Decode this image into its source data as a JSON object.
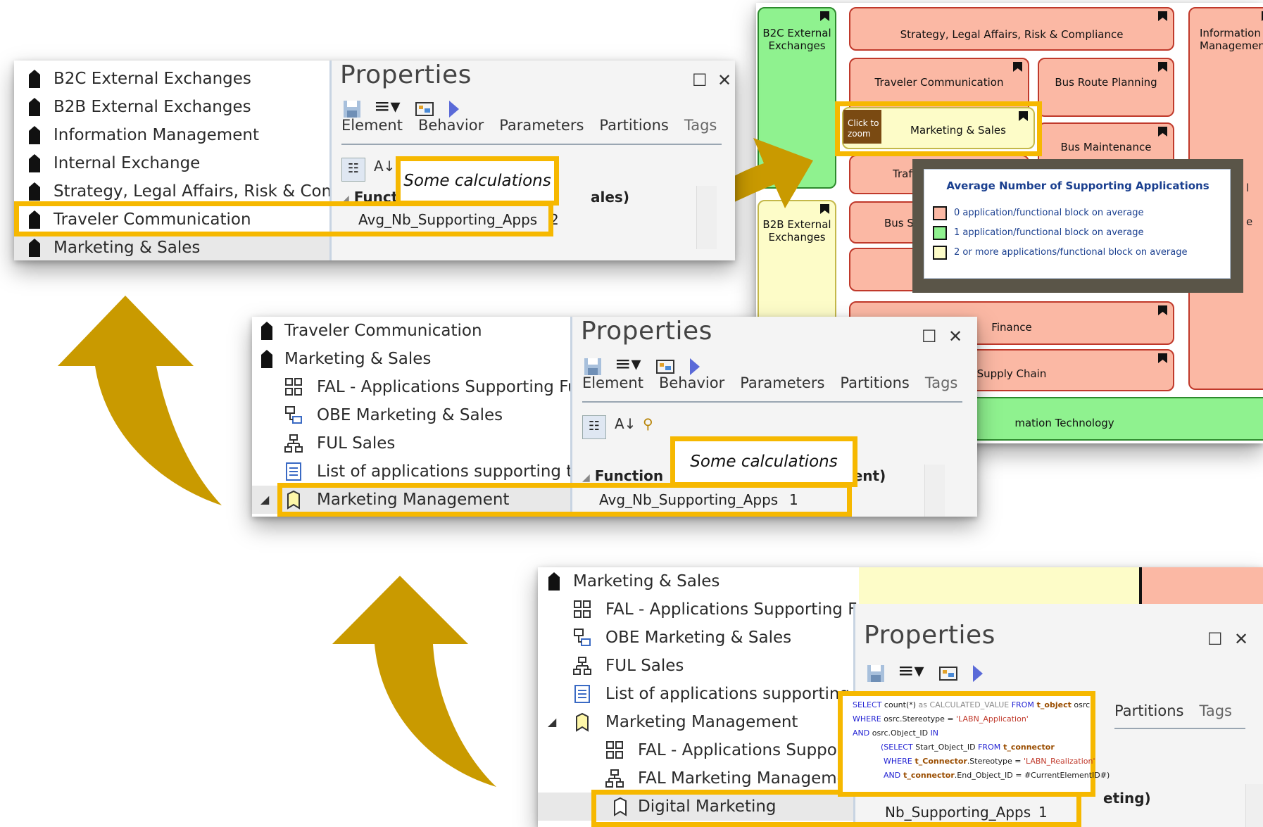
{
  "colors": {
    "highlight": "#f6b800",
    "arrow": "#c99a00",
    "block_red": "#fbb8a4",
    "block_green": "#8ff28f",
    "block_yellow": "#fdfcc8",
    "legend_frame": "#5a5548",
    "legend_text": "#1a3f8f"
  },
  "panel1": {
    "tree": [
      {
        "label": "B2C External Exchanges",
        "icon": "package-icon"
      },
      {
        "label": "B2B External Exchanges",
        "icon": "package-icon"
      },
      {
        "label": "Information Management",
        "icon": "package-icon"
      },
      {
        "label": "Internal Exchange",
        "icon": "package-icon"
      },
      {
        "label": "Strategy, Legal Affairs, Risk & Compli",
        "icon": "package-icon"
      },
      {
        "label": "Traveler Communication",
        "icon": "package-icon"
      },
      {
        "label": "Marketing & Sales",
        "icon": "package-icon"
      }
    ],
    "properties": {
      "title": "Properties",
      "tabs": [
        "Element",
        "Behavior",
        "Parameters",
        "Partitions",
        "Tags"
      ],
      "section": "Functiona",
      "section_suffix": "ales)",
      "row_name": "Avg_Nb_Supporting_Apps",
      "row_value": "2"
    },
    "callout": "Some calculations"
  },
  "panel2": {
    "tree": [
      {
        "label": "Traveler Communication",
        "icon": "package-icon"
      },
      {
        "label": "Marketing & Sales",
        "icon": "package-icon"
      },
      {
        "label": "FAL - Applications Supporting Fu",
        "icon": "diagram-icon"
      },
      {
        "label": "OBE Marketing & Sales",
        "icon": "obe-diagram-icon"
      },
      {
        "label": "FUL Sales",
        "icon": "hierarchy-icon"
      },
      {
        "label": "List of applications supporting the",
        "icon": "list-icon"
      },
      {
        "label": "Marketing Management",
        "icon": "function-icon"
      }
    ],
    "properties": {
      "title": "Properties",
      "tabs": [
        "Element",
        "Behavior",
        "Parameters",
        "Partitions",
        "Tags"
      ],
      "section": "Function",
      "section_suffix": "gement)",
      "row_name": "Avg_Nb_Supporting_Apps",
      "row_value": "1"
    },
    "callout": "Some calculations"
  },
  "panel3": {
    "tree": [
      {
        "label": "Marketing & Sales",
        "icon": "package-icon"
      },
      {
        "label": "FAL - Applications Supporting Fu",
        "icon": "diagram-icon"
      },
      {
        "label": "OBE Marketing & Sales",
        "icon": "obe-diagram-icon"
      },
      {
        "label": "FUL Sales",
        "icon": "hierarchy-icon"
      },
      {
        "label": "List of applications supporting t",
        "icon": "list-icon"
      },
      {
        "label": "Marketing Management",
        "icon": "function-icon"
      },
      {
        "label": "FAL - Applications Suppor",
        "icon": "diagram-icon"
      },
      {
        "label": "FAL Marketing Manageme",
        "icon": "hierarchy-icon"
      },
      {
        "label": "Digital Marketing",
        "icon": "function-icon"
      }
    ],
    "properties": {
      "title": "Properties",
      "tabs": [
        "Partitions",
        "Tags"
      ],
      "section_suffix": "eting)",
      "row_name": "Nb_Supporting_Apps",
      "row_value": "1"
    },
    "sql": {
      "l1a": "SELECT",
      "l1b": " count(*) ",
      "l1c": "as CALCULATED_VALUE ",
      "l1d": "FROM",
      "l1e": " t_object",
      "l1f": " osrc",
      "l2a": "WHERE",
      "l2b": " osrc.Stereotype = ",
      "l2c": "'LABN_Application'",
      "l3a": "AND",
      "l3b": "  osrc.Object_ID ",
      "l3c": "IN",
      "l4a": "(SELECT",
      "l4b": " Start_Object_ID ",
      "l4c": "FROM",
      "l4d": " t_connector",
      "l5a": "WHERE",
      "l5b": " t_Connector",
      "l5c": ".Stereotype = ",
      "l5d": "'LABN_Realization'",
      "l6a": "AND",
      "l6b": "  t_connector",
      "l6c": ".End_Object_ID = #CurrentElementID#)"
    }
  },
  "diagram": {
    "blocks": {
      "b2c": "B2C External Exchanges",
      "strategy": "Strategy, Legal Affairs, Risk & Compliance",
      "info": "Information Management",
      "traveler": "Traveler Communication",
      "bus_route": "Bus Route Planning",
      "marketing": "Marketing & Sales",
      "bus_maint": "Bus Maintenance",
      "traff": "Traff",
      "b2b": "B2B External Exchanges",
      "bus_st": "Bus St",
      "finance": "Finance",
      "supply": "Supply Chain",
      "it": "mation Technology",
      "edge_l": "l",
      "edge_e": "e"
    },
    "zoom_badge": "Click to zoom",
    "legend": {
      "title": "Average Number of Supporting Applications",
      "items": [
        {
          "label": "0 application/functional block on average",
          "color": "#fbb8a4"
        },
        {
          "label": "1 application/functional block on average",
          "color": "#8ff28f"
        },
        {
          "label": "2 or more applications/functional block on average",
          "color": "#fdfcc8"
        }
      ]
    }
  }
}
